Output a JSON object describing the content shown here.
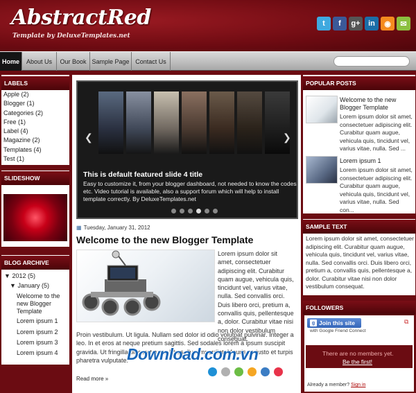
{
  "header": {
    "title": "AbstractRed",
    "subtitle": "Template by DeluxeTemplates.net",
    "social": [
      {
        "icon": "twitter-icon",
        "glyph": "t",
        "color": "#3fa9df"
      },
      {
        "icon": "facebook-icon",
        "glyph": "f",
        "color": "#3b5998"
      },
      {
        "icon": "google-plus-icon",
        "glyph": "g+",
        "color": "#555555"
      },
      {
        "icon": "linkedin-icon",
        "glyph": "in",
        "color": "#1b6ea8"
      },
      {
        "icon": "rss-icon",
        "glyph": "◉",
        "color": "#f58b1f"
      },
      {
        "icon": "email-icon",
        "glyph": "✉",
        "color": "#8cc03f"
      }
    ]
  },
  "nav": {
    "items": [
      "Home",
      "About Us",
      "Our Book",
      "Sample Page",
      "Contact Us"
    ]
  },
  "labels": {
    "title": "LABELS",
    "items": [
      "Apple (2)",
      "Blogger (1)",
      "Categories (2)",
      "Free (1)",
      "Label (4)",
      "Magazine (2)",
      "Templates (4)",
      "Test (1)"
    ]
  },
  "slideshow": {
    "title": "SLIDESHOW"
  },
  "archive": {
    "title": "BLOG ARCHIVE",
    "year": "2012",
    "year_count": "(5)",
    "month": "January",
    "month_count": "(5)",
    "posts": [
      "Welcome to the new Blogger Template",
      "Lorem ipsum 1",
      "Lorem ipsum 2",
      "Lorem ipsum 3",
      "Lorem ipsum 4"
    ]
  },
  "slider": {
    "title": "This is default featured slide 4 title",
    "body": "Easy to customize it, from your blogger dashboard, not needed to know the codes etc. Video tutorial is available, also a support forum which will help to install template correctly. By DeluxeTemplates.net"
  },
  "post": {
    "date": "Tuesday, January 31, 2012",
    "title": "Welcome to the new Blogger Template",
    "text_side": "Lorem ipsum dolor sit amet, consectetuer adipiscing elit. Curabitur quam augue, vehicula quis, tincidunt vel, varius vitae, nulla. Sed convallis orci. Duis libero orci, pretium a, convallis quis, pellentesque a, dolor. Curabitur vitae nisi non dolor vestibulum consequat.",
    "text_full": "Proin vestibulum. Ut ligula. Nullam sed dolor id odio volutpat pulvinar. Integer a leo. In et eros at neque pretium sagittis. Sed sodales lorem a ipsum suscipit gravida. Ut fringilla placerat arcu. Phasellus imperdiet. Mauris ac justo et turpis pharetra vulputate.",
    "read_more": "Read more »",
    "share_colors": [
      "#1e90d6",
      "#b0b0b0",
      "#6cbd45",
      "#f5a623",
      "#3b7dc4",
      "#e8334a"
    ]
  },
  "watermark": "Download.com.vn",
  "popular": {
    "title": "POPULAR POSTS",
    "items": [
      {
        "title": "Welcome to the new Blogger Template",
        "body": "Lorem ipsum dolor sit amet, consectetuer adipiscing elit. Curabitur quam augue, vehicula quis, tincidunt vel, varius vitae, nulla. Sed ..."
      },
      {
        "title": "Lorem ipsum 1",
        "body": "Lorem ipsum dolor sit amet, consectetuer adipiscing elit. Curabitur quam augue, vehicula quis, tincidunt vel, varius vitae, nulla. Sed con..."
      }
    ]
  },
  "sample_text": {
    "title": "SAMPLE TEXT",
    "body": "Lorem ipsum dolor sit amet, consectetuer adipiscing elit. Curabitur quam augue, vehicula quis, tincidunt vel, varius vitae, nulla. Sed convallis orci. Duis libero orci, pretium a, convallis quis, pellentesque a, dolor. Curabitur vitae nisi non dolor vestibulum consequat."
  },
  "followers": {
    "title": "FOLLOWERS",
    "join_label": "Join this site",
    "gfc_label": "with Google Friend Connect",
    "no_members": "There are no members yet.",
    "be_first": "Be the first!",
    "already_member": "Already a member?",
    "sign_in": "Sign in"
  }
}
